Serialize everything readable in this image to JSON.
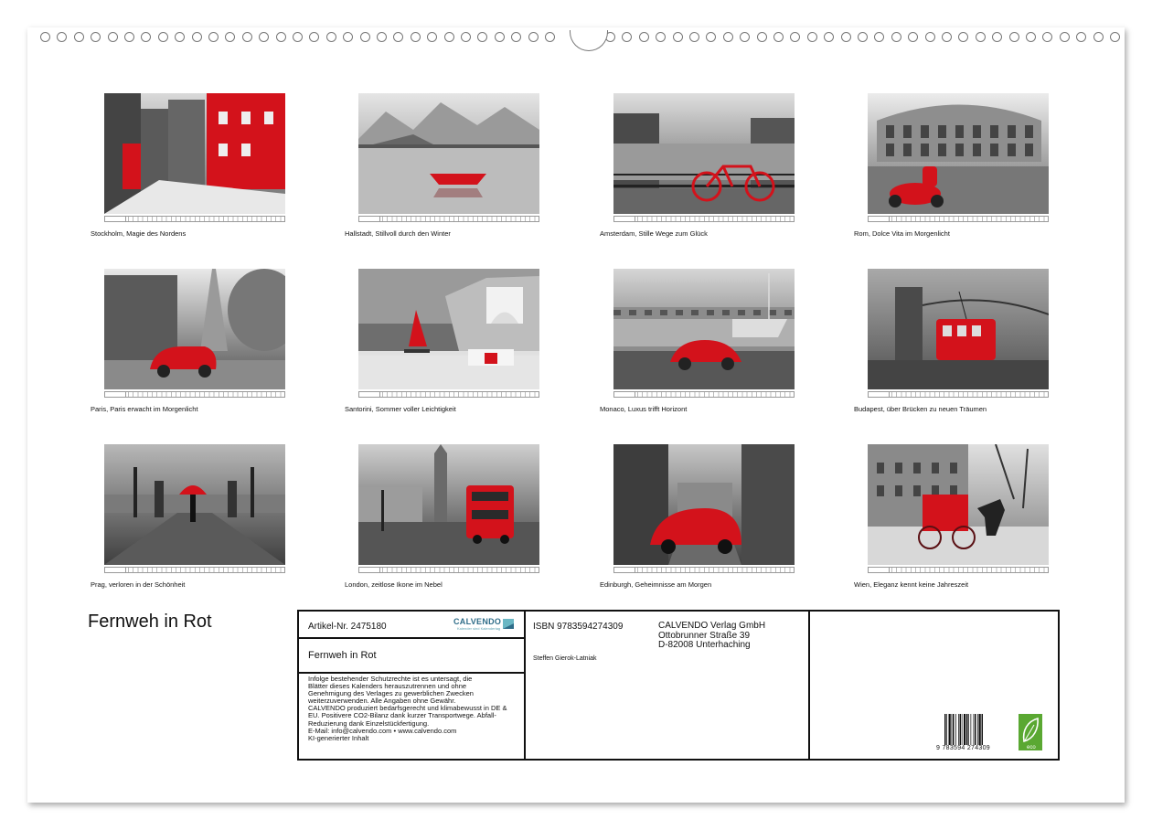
{
  "calendar": {
    "title": "Fernweh in Rot",
    "months": [
      {
        "caption": "Stockholm, Magie des Nordens",
        "scene": "stockholm"
      },
      {
        "caption": "Hallstadt, Stillvoll durch den Winter",
        "scene": "hallstatt"
      },
      {
        "caption": "Amsterdam, Stille Wege zum Glück",
        "scene": "amsterdam"
      },
      {
        "caption": "Rom, Dolce Vita im Morgenlicht",
        "scene": "rome"
      },
      {
        "caption": "Paris, Paris erwacht im Morgenlicht",
        "scene": "paris"
      },
      {
        "caption": "Santorini, Sommer voller Leichtigkeit",
        "scene": "santorini"
      },
      {
        "caption": "Monaco, Luxus trifft Horizont",
        "scene": "monaco"
      },
      {
        "caption": "Budapest, über Brücken zu neuen Träumen",
        "scene": "budapest"
      },
      {
        "caption": "Prag, verloren in der Schönheit",
        "scene": "prague"
      },
      {
        "caption": "London, zeitlose Ikone im Nebel",
        "scene": "london"
      },
      {
        "caption": "Edinburgh, Geheimnisse am Morgen",
        "scene": "edinburgh"
      },
      {
        "caption": "Wien, Eleganz kennt keine Jahreszeit",
        "scene": "vienna"
      }
    ]
  },
  "infobox": {
    "artikel": "Artikel-Nr. 2475180",
    "brand": "CALVENDO",
    "brand_sub": "Kalender sind Kalendertag",
    "title": "Fernweh in Rot",
    "legal": [
      "Infolge bestehender Schutzrechte ist es untersagt, die",
      "Blätter dieses Kalenders herauszutrennen und ohne",
      "Genehmigung des Verlages zu gewerblichen Zwecken",
      "weiterzuverwenden. Alle Angaben ohne Gewähr.",
      "CALVENDO produziert bedarfsgerecht und klimabewusst in DE &",
      "EU. Positivere CO2-Bilanz dank kurzer Transportwege. Abfall-",
      "Reduzierung dank Einzelstückfertigung.",
      "E-Mail: info@calvendo.com • www.calvendo.com",
      "KI-generierter Inhalt"
    ],
    "isbn": "ISBN 9783594274309",
    "author": "Steffen Gierok-Latniak",
    "publisher": [
      "CALVENDO Verlag GmbH",
      "Ottobrunner Straße 39",
      "D-82008 Unterhaching"
    ],
    "barcode_number": "9 783594 274309",
    "eco_label": "eco"
  },
  "colors": {
    "accent_red": "#d3121b",
    "brand_teal": "#2f6d89",
    "eco_green": "#5aa832"
  }
}
